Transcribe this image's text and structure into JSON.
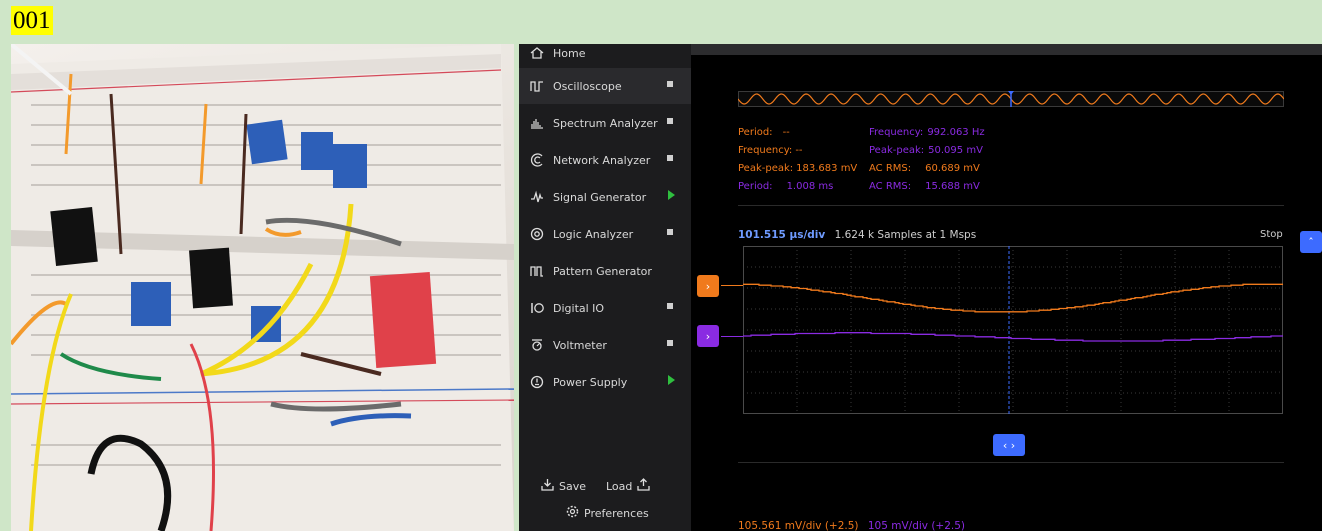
{
  "corner_label": "001",
  "sidebar": {
    "items": [
      {
        "label": "Home",
        "icon": "home-icon",
        "status": "none"
      },
      {
        "label": "Oscilloscope",
        "icon": "oscilloscope-icon",
        "status": "stop"
      },
      {
        "label": "Spectrum Analyzer",
        "icon": "spectrum-icon",
        "status": "stop"
      },
      {
        "label": "Network Analyzer",
        "icon": "network-icon",
        "status": "stop"
      },
      {
        "label": "Signal Generator",
        "icon": "signal-icon",
        "status": "play"
      },
      {
        "label": "Logic Analyzer",
        "icon": "logic-icon",
        "status": "stop"
      },
      {
        "label": "Pattern Generator",
        "icon": "pattern-icon",
        "status": "none"
      },
      {
        "label": "Digital IO",
        "icon": "digital-io-icon",
        "status": "stop"
      },
      {
        "label": "Voltmeter",
        "icon": "voltmeter-icon",
        "status": "stop"
      },
      {
        "label": "Power Supply",
        "icon": "power-icon",
        "status": "play"
      }
    ],
    "save_label": "Save",
    "load_label": "Load",
    "preferences_label": "Preferences"
  },
  "measurements": {
    "ch1": [
      {
        "k": "Period:",
        "v": "--"
      },
      {
        "k": "Frequency:",
        "v": "--"
      },
      {
        "k": "Peak-peak:",
        "v": "183.683 mV"
      },
      {
        "k": "Period:",
        "v": "1.008 ms"
      }
    ],
    "ch2": [
      {
        "k": "Frequency:",
        "v": "992.063 Hz"
      },
      {
        "k": "Peak-peak:",
        "v": "50.095 mV"
      },
      {
        "k": "AC RMS:",
        "v": "60.689 mV"
      },
      {
        "k": "AC RMS:",
        "v": "15.688 mV"
      }
    ]
  },
  "scope": {
    "timebase": "101.515 μs/div",
    "samples": "1.624 k Samples at 1 Msps",
    "run_state": "Stop",
    "ch1_scale": "105.561 mV/div (+2.5)",
    "ch2_scale": "105 mV/div (+2.5)",
    "ch1_color": "#f07a1c",
    "ch2_color": "#8a2be2",
    "accent": "#3d6bff"
  }
}
